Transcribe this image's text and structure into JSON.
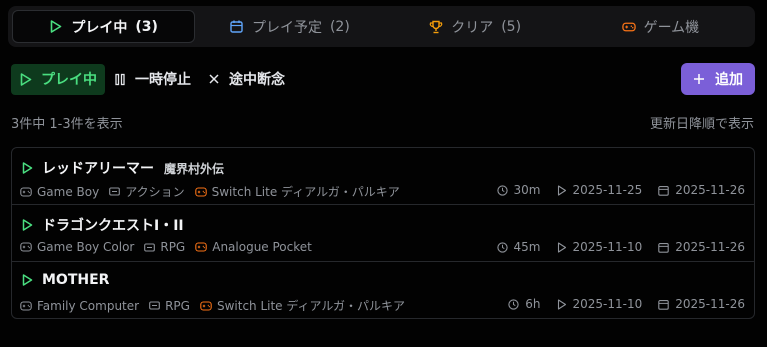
{
  "tabs": [
    {
      "label": "プレイ中",
      "count": "(3)",
      "icon": "play-icon",
      "color": "#4ade80",
      "active": true
    },
    {
      "label": "プレイ予定",
      "count": "(2)",
      "icon": "calendar-icon",
      "color": "#60a5fa"
    },
    {
      "label": "クリア",
      "count": "(5)",
      "icon": "trophy-icon",
      "color": "#f59e0b"
    },
    {
      "label": "ゲーム機",
      "count": "",
      "icon": "gamepad-icon",
      "color": "#f97316"
    }
  ],
  "filters": [
    {
      "label": "プレイ中",
      "icon": "play-icon",
      "active": true
    },
    {
      "label": "一時停止",
      "icon": "pause-icon"
    },
    {
      "label": "途中断念",
      "icon": "close-icon"
    }
  ],
  "add_button": {
    "label": "追加",
    "icon": "plus-icon"
  },
  "summary": {
    "count_text": "3件中 1-3件を表示",
    "sort_text": "更新日降順で表示"
  },
  "games": [
    {
      "title": "レッドアリーマー",
      "subtitle": "魔界村外伝",
      "platform": "Game Boy",
      "genre": "アクション",
      "device": "Switch Lite ディアルガ・パルキア",
      "playtime": "30m",
      "started": "2025-11-25",
      "updated": "2025-11-26"
    },
    {
      "title": "ドラゴンクエストI・II",
      "subtitle": "",
      "platform": "Game Boy Color",
      "genre": "RPG",
      "device": "Analogue Pocket",
      "playtime": "45m",
      "started": "2025-11-10",
      "updated": "2025-11-26"
    },
    {
      "title": "MOTHER",
      "subtitle": "",
      "platform": "Family Computer",
      "genre": "RPG",
      "device": "Switch Lite ディアルガ・パルキア",
      "playtime": "6h",
      "started": "2025-11-10",
      "updated": "2025-11-26"
    }
  ],
  "colors": {
    "accent": "#7b5fd8",
    "play_green": "#4ade80",
    "device_orange": "#f97316"
  }
}
